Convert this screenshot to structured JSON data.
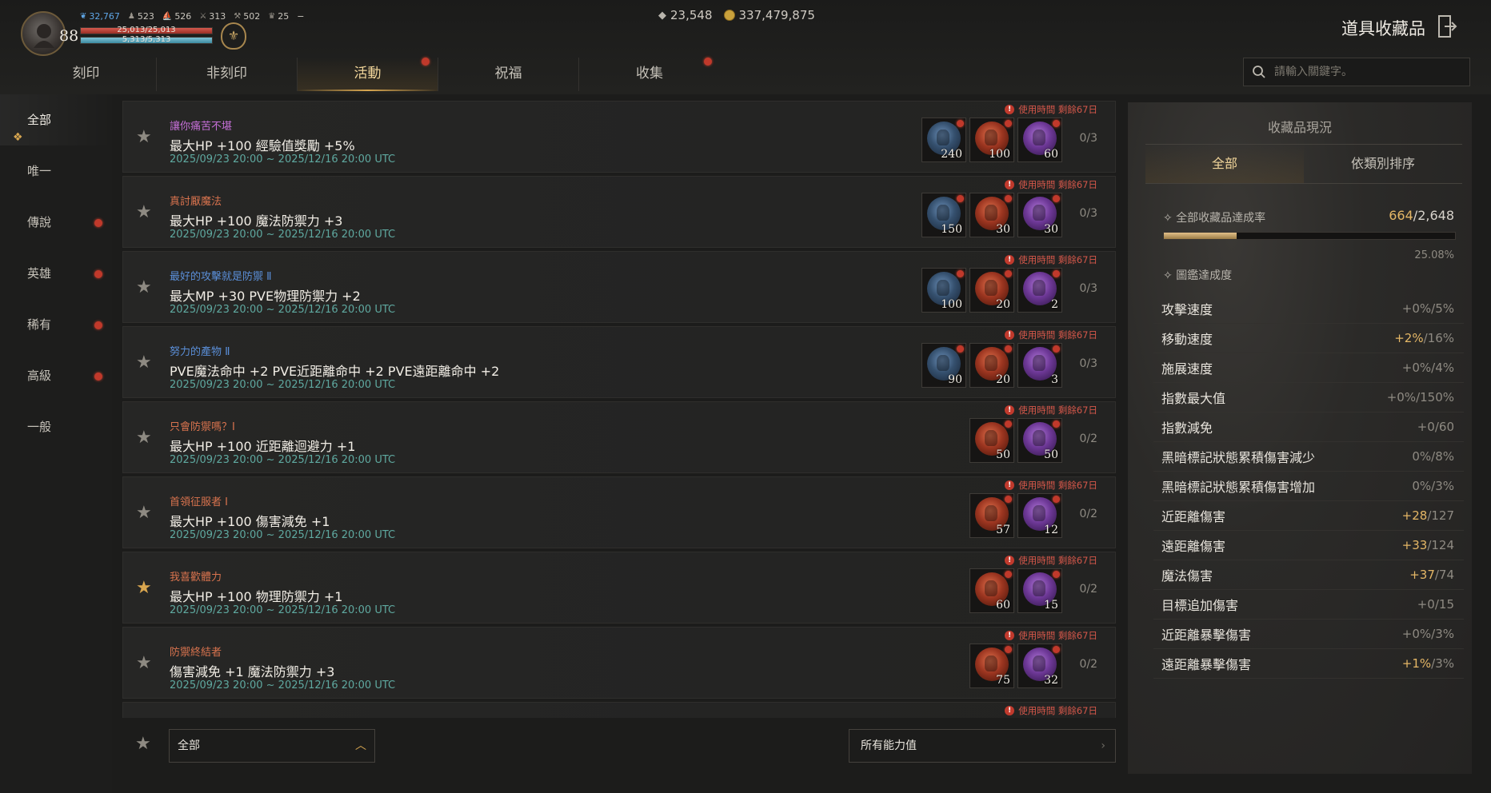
{
  "player": {
    "level": "88",
    "stats": [
      {
        "icon": "feather-icon",
        "value": "32,767",
        "accent": true
      },
      {
        "icon": "people-icon",
        "value": "523"
      },
      {
        "icon": "ship-icon",
        "value": "526"
      },
      {
        "icon": "crossed-swords-icon",
        "value": "313"
      },
      {
        "icon": "anvil-icon",
        "value": "502"
      },
      {
        "icon": "trophy-icon",
        "value": "25"
      }
    ],
    "stats_suffix": "−",
    "hp_text": "25,013/25,013",
    "mp_text": "5,313/5,313"
  },
  "currency": {
    "gem": "23,548",
    "gold": "337,479,875"
  },
  "page_title": "道具收藏品",
  "tabs": [
    {
      "label": "刻印",
      "active": false,
      "dot": false
    },
    {
      "label": "非刻印",
      "active": false,
      "dot": false
    },
    {
      "label": "活動",
      "active": true,
      "dot": true
    },
    {
      "label": "祝福",
      "active": false,
      "dot": false
    },
    {
      "label": "收集",
      "active": false,
      "dot": true
    }
  ],
  "search": {
    "placeholder": "請輸入關鍵字。"
  },
  "sidebar": [
    {
      "label": "全部",
      "active": true,
      "dot": false
    },
    {
      "label": "唯一",
      "active": false,
      "dot": false
    },
    {
      "label": "傳說",
      "active": false,
      "dot": true
    },
    {
      "label": "英雄",
      "active": false,
      "dot": true
    },
    {
      "label": "稀有",
      "active": false,
      "dot": true
    },
    {
      "label": "高級",
      "active": false,
      "dot": true
    },
    {
      "label": "一般",
      "active": false,
      "dot": false
    }
  ],
  "collections": [
    {
      "title": "讓你痛苦不堪",
      "title_color": "#c46fd6",
      "desc": "最大HP +100 經驗值獎勵 +5%",
      "date": "2025/09/23 20:00 ~ 2025/12/16 20:00 UTC",
      "timer": "使用時間 剩餘67日",
      "count": "0/3",
      "fav": false,
      "items": [
        {
          "color": "blue",
          "qty": "240"
        },
        {
          "color": "red",
          "qty": "100"
        },
        {
          "color": "purple",
          "qty": "60"
        }
      ]
    },
    {
      "title": "真討厭魔法",
      "title_color": "#d8734e",
      "desc": "最大HP +100 魔法防禦力 +3",
      "date": "2025/09/23 20:00 ~ 2025/12/16 20:00 UTC",
      "timer": "使用時間 剩餘67日",
      "count": "0/3",
      "fav": false,
      "items": [
        {
          "color": "blue",
          "qty": "150"
        },
        {
          "color": "red",
          "qty": "30"
        },
        {
          "color": "purple",
          "qty": "30"
        }
      ]
    },
    {
      "title": "最好的攻擊就是防禦 Ⅱ",
      "title_color": "#5b8fd8",
      "desc": "最大MP +30 PVE物理防禦力 +2",
      "date": "2025/09/23 20:00 ~ 2025/12/16 20:00 UTC",
      "timer": "使用時間 剩餘67日",
      "count": "0/3",
      "fav": false,
      "items": [
        {
          "color": "blue",
          "qty": "100"
        },
        {
          "color": "red",
          "qty": "20"
        },
        {
          "color": "purple",
          "qty": "2"
        }
      ]
    },
    {
      "title": "努力的產物 Ⅱ",
      "title_color": "#5b8fd8",
      "desc": "PVE魔法命中 +2 PVE近距離命中 +2 PVE遠距離命中 +2",
      "date": "2025/09/23 20:00 ~ 2025/12/16 20:00 UTC",
      "timer": "使用時間 剩餘67日",
      "count": "0/3",
      "fav": false,
      "items": [
        {
          "color": "blue",
          "qty": "90"
        },
        {
          "color": "red",
          "qty": "20"
        },
        {
          "color": "purple",
          "qty": "3"
        }
      ]
    },
    {
      "title": "只會防禦嗎？Ⅰ",
      "title_color": "#d8734e",
      "desc": "最大HP +100 近距離迴避力 +1",
      "date": "2025/09/23 20:00 ~ 2025/12/16 20:00 UTC",
      "timer": "使用時間 剩餘67日",
      "count": "0/2",
      "fav": false,
      "items": [
        {
          "color": "red",
          "qty": "50"
        },
        {
          "color": "purple",
          "qty": "50"
        }
      ]
    },
    {
      "title": "首領征服者 Ⅰ",
      "title_color": "#d8734e",
      "desc": "最大HP +100 傷害減免 +1",
      "date": "2025/09/23 20:00 ~ 2025/12/16 20:00 UTC",
      "timer": "使用時間 剩餘67日",
      "count": "0/2",
      "fav": false,
      "items": [
        {
          "color": "red",
          "qty": "57"
        },
        {
          "color": "purple",
          "qty": "12"
        }
      ]
    },
    {
      "title": "我喜歡體力",
      "title_color": "#d8734e",
      "desc": "最大HP +100 物理防禦力 +1",
      "date": "2025/09/23 20:00 ~ 2025/12/16 20:00 UTC",
      "timer": "使用時間 剩餘67日",
      "count": "0/2",
      "fav": true,
      "items": [
        {
          "color": "red",
          "qty": "60"
        },
        {
          "color": "purple",
          "qty": "15"
        }
      ]
    },
    {
      "title": "防禦終結者",
      "title_color": "#d8734e",
      "desc": "傷害減免 +1 魔法防禦力 +3",
      "date": "2025/09/23 20:00 ~ 2025/12/16 20:00 UTC",
      "timer": "使用時間 剩餘67日",
      "count": "0/2",
      "fav": false,
      "items": [
        {
          "color": "red",
          "qty": "75"
        },
        {
          "color": "purple",
          "qty": "32"
        }
      ]
    }
  ],
  "partial_timer": "使用時間 剩餘67日",
  "filter": {
    "dropdown_value": "全部",
    "all_stats_label": "所有能力值"
  },
  "panel": {
    "title": "收藏品現況",
    "tabs": [
      {
        "label": "全部",
        "active": true
      },
      {
        "label": "依類別排序",
        "active": false
      }
    ],
    "achievement_label": "全部收藏品達成率",
    "achievement_current": "664",
    "achievement_total": "/2,648",
    "achievement_percent": "25.08%",
    "achievement_fraction": 0.2508,
    "codex_label": "圖鑑達成度",
    "stats": [
      {
        "name": "攻擊速度",
        "current": "+0%",
        "max": "/5%",
        "hl": false
      },
      {
        "name": "移動速度",
        "current": "+2%",
        "max": "/16%",
        "hl": true
      },
      {
        "name": "施展速度",
        "current": "+0%",
        "max": "/4%",
        "hl": false
      },
      {
        "name": "指數最大值",
        "current": "+0%",
        "max": "/150%",
        "hl": false
      },
      {
        "name": "指數減免",
        "current": "+0",
        "max": "/60",
        "hl": false
      },
      {
        "name": "黑暗標記狀態累積傷害減少",
        "current": "0%",
        "max": "/8%",
        "hl": false
      },
      {
        "name": "黑暗標記狀態累積傷害增加",
        "current": "0%",
        "max": "/3%",
        "hl": false
      },
      {
        "name": "近距離傷害",
        "current": "+28",
        "max": "/127",
        "hl": true
      },
      {
        "name": "遠距離傷害",
        "current": "+33",
        "max": "/124",
        "hl": true
      },
      {
        "name": "魔法傷害",
        "current": "+37",
        "max": "/74",
        "hl": true
      },
      {
        "name": "目標追加傷害",
        "current": "+0",
        "max": "/15",
        "hl": false
      },
      {
        "name": "近距離暴擊傷害",
        "current": "+0%",
        "max": "/3%",
        "hl": false
      },
      {
        "name": "遠距離暴擊傷害",
        "current": "+1%",
        "max": "/3%",
        "hl": true
      }
    ]
  }
}
